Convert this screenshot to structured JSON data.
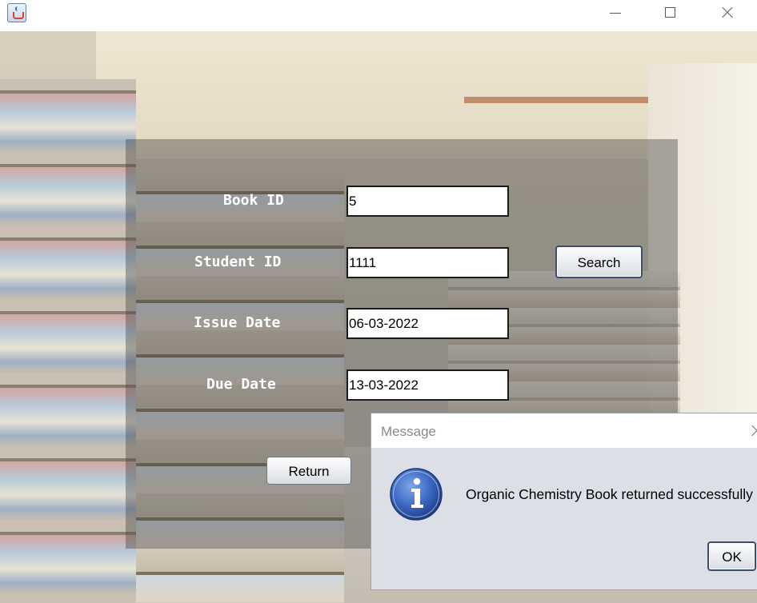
{
  "window": {
    "icon": "java-cup-icon"
  },
  "form": {
    "book_id_label": "Book ID",
    "book_id_value": "5",
    "student_id_label": "Student ID",
    "student_id_value": "1111",
    "issue_date_label": "Issue Date",
    "issue_date_value": "06-03-2022",
    "due_date_label": "Due Date",
    "due_date_value": "13-03-2022",
    "search_button": "Search",
    "return_button": "Return"
  },
  "dialog": {
    "title": "Message",
    "icon": "info-icon",
    "message": "Organic Chemistry Book returned successfully",
    "ok_button": "OK"
  }
}
